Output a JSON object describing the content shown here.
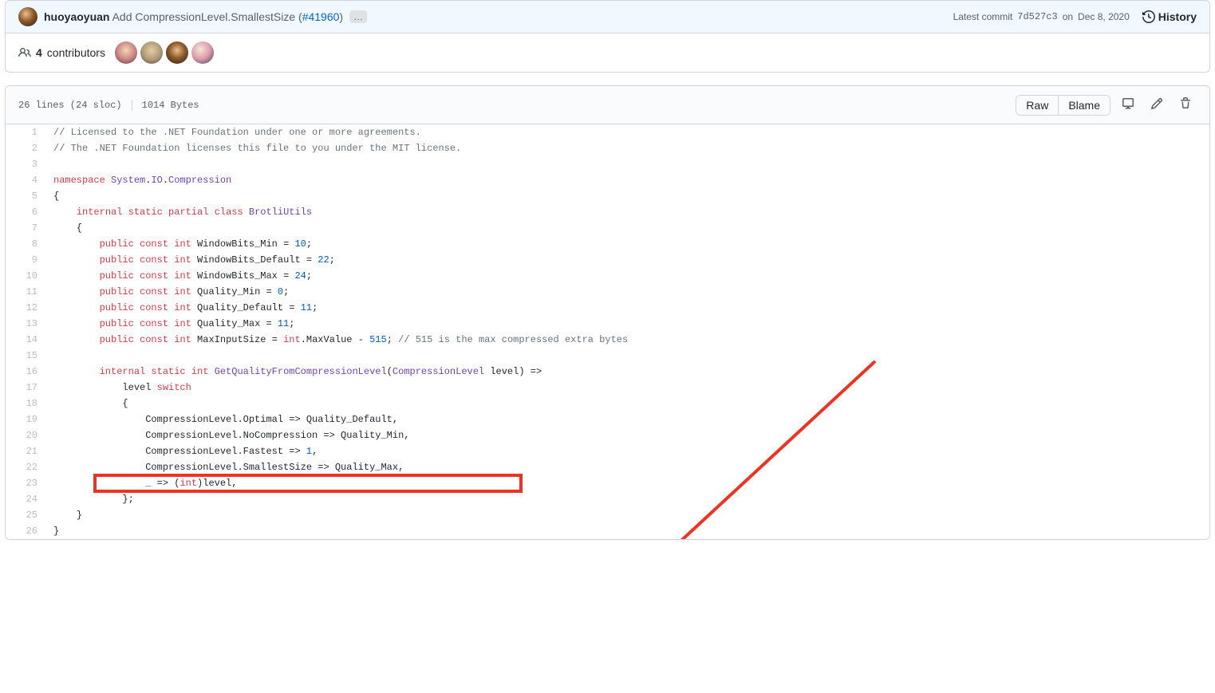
{
  "commit": {
    "author": "huoyaoyuan",
    "message_prefix": "Add CompressionLevel.SmallestSize (",
    "pr_number": "#41960",
    "message_suffix": ")",
    "ellipsis": "…",
    "latest_label": "Latest commit",
    "sha": "7d527c3",
    "on": "on",
    "date": "Dec 8, 2020",
    "history": "History"
  },
  "contributors": {
    "count": "4",
    "label": "contributors"
  },
  "file": {
    "lines_label": "26 lines (24 sloc)",
    "size_label": "1014 Bytes",
    "raw": "Raw",
    "blame": "Blame"
  },
  "code_lines": [
    {
      "n": "1",
      "tokens": [
        {
          "cls": "c-comment",
          "t": "// Licensed to the .NET Foundation under one or more agreements."
        }
      ]
    },
    {
      "n": "2",
      "tokens": [
        {
          "cls": "c-comment",
          "t": "// The .NET Foundation licenses this file to you under the MIT license."
        }
      ]
    },
    {
      "n": "3",
      "tokens": []
    },
    {
      "n": "4",
      "tokens": [
        {
          "cls": "c-keyword",
          "t": "namespace"
        },
        {
          "cls": "",
          "t": " "
        },
        {
          "cls": "c-type",
          "t": "System"
        },
        {
          "cls": "",
          "t": "."
        },
        {
          "cls": "c-type",
          "t": "IO"
        },
        {
          "cls": "",
          "t": "."
        },
        {
          "cls": "c-type",
          "t": "Compression"
        }
      ]
    },
    {
      "n": "5",
      "tokens": [
        {
          "cls": "",
          "t": "{"
        }
      ]
    },
    {
      "n": "6",
      "tokens": [
        {
          "cls": "",
          "t": "    "
        },
        {
          "cls": "c-keyword",
          "t": "internal"
        },
        {
          "cls": "",
          "t": " "
        },
        {
          "cls": "c-keyword",
          "t": "static"
        },
        {
          "cls": "",
          "t": " "
        },
        {
          "cls": "c-keyword",
          "t": "partial"
        },
        {
          "cls": "",
          "t": " "
        },
        {
          "cls": "c-keyword",
          "t": "class"
        },
        {
          "cls": "",
          "t": " "
        },
        {
          "cls": "c-type",
          "t": "BrotliUtils"
        }
      ]
    },
    {
      "n": "7",
      "tokens": [
        {
          "cls": "",
          "t": "    {"
        }
      ]
    },
    {
      "n": "8",
      "tokens": [
        {
          "cls": "",
          "t": "        "
        },
        {
          "cls": "c-keyword",
          "t": "public"
        },
        {
          "cls": "",
          "t": " "
        },
        {
          "cls": "c-keyword",
          "t": "const"
        },
        {
          "cls": "",
          "t": " "
        },
        {
          "cls": "c-keyword",
          "t": "int"
        },
        {
          "cls": "",
          "t": " WindowBits_Min = "
        },
        {
          "cls": "c-num",
          "t": "10"
        },
        {
          "cls": "",
          "t": ";"
        }
      ]
    },
    {
      "n": "9",
      "tokens": [
        {
          "cls": "",
          "t": "        "
        },
        {
          "cls": "c-keyword",
          "t": "public"
        },
        {
          "cls": "",
          "t": " "
        },
        {
          "cls": "c-keyword",
          "t": "const"
        },
        {
          "cls": "",
          "t": " "
        },
        {
          "cls": "c-keyword",
          "t": "int"
        },
        {
          "cls": "",
          "t": " WindowBits_Default = "
        },
        {
          "cls": "c-num",
          "t": "22"
        },
        {
          "cls": "",
          "t": ";"
        }
      ]
    },
    {
      "n": "10",
      "tokens": [
        {
          "cls": "",
          "t": "        "
        },
        {
          "cls": "c-keyword",
          "t": "public"
        },
        {
          "cls": "",
          "t": " "
        },
        {
          "cls": "c-keyword",
          "t": "const"
        },
        {
          "cls": "",
          "t": " "
        },
        {
          "cls": "c-keyword",
          "t": "int"
        },
        {
          "cls": "",
          "t": " WindowBits_Max = "
        },
        {
          "cls": "c-num",
          "t": "24"
        },
        {
          "cls": "",
          "t": ";"
        }
      ]
    },
    {
      "n": "11",
      "tokens": [
        {
          "cls": "",
          "t": "        "
        },
        {
          "cls": "c-keyword",
          "t": "public"
        },
        {
          "cls": "",
          "t": " "
        },
        {
          "cls": "c-keyword",
          "t": "const"
        },
        {
          "cls": "",
          "t": " "
        },
        {
          "cls": "c-keyword",
          "t": "int"
        },
        {
          "cls": "",
          "t": " Quality_Min = "
        },
        {
          "cls": "c-num",
          "t": "0"
        },
        {
          "cls": "",
          "t": ";"
        }
      ]
    },
    {
      "n": "12",
      "tokens": [
        {
          "cls": "",
          "t": "        "
        },
        {
          "cls": "c-keyword",
          "t": "public"
        },
        {
          "cls": "",
          "t": " "
        },
        {
          "cls": "c-keyword",
          "t": "const"
        },
        {
          "cls": "",
          "t": " "
        },
        {
          "cls": "c-keyword",
          "t": "int"
        },
        {
          "cls": "",
          "t": " Quality_Default = "
        },
        {
          "cls": "c-num",
          "t": "11"
        },
        {
          "cls": "",
          "t": ";"
        }
      ]
    },
    {
      "n": "13",
      "tokens": [
        {
          "cls": "",
          "t": "        "
        },
        {
          "cls": "c-keyword",
          "t": "public"
        },
        {
          "cls": "",
          "t": " "
        },
        {
          "cls": "c-keyword",
          "t": "const"
        },
        {
          "cls": "",
          "t": " "
        },
        {
          "cls": "c-keyword",
          "t": "int"
        },
        {
          "cls": "",
          "t": " Quality_Max = "
        },
        {
          "cls": "c-num",
          "t": "11"
        },
        {
          "cls": "",
          "t": ";"
        }
      ]
    },
    {
      "n": "14",
      "tokens": [
        {
          "cls": "",
          "t": "        "
        },
        {
          "cls": "c-keyword",
          "t": "public"
        },
        {
          "cls": "",
          "t": " "
        },
        {
          "cls": "c-keyword",
          "t": "const"
        },
        {
          "cls": "",
          "t": " "
        },
        {
          "cls": "c-keyword",
          "t": "int"
        },
        {
          "cls": "",
          "t": " MaxInputSize = "
        },
        {
          "cls": "c-keyword",
          "t": "int"
        },
        {
          "cls": "",
          "t": ".MaxValue - "
        },
        {
          "cls": "c-num",
          "t": "515"
        },
        {
          "cls": "",
          "t": "; "
        },
        {
          "cls": "c-comment",
          "t": "// 515 is the max compressed extra bytes"
        }
      ]
    },
    {
      "n": "15",
      "tokens": []
    },
    {
      "n": "16",
      "tokens": [
        {
          "cls": "",
          "t": "        "
        },
        {
          "cls": "c-keyword",
          "t": "internal"
        },
        {
          "cls": "",
          "t": " "
        },
        {
          "cls": "c-keyword",
          "t": "static"
        },
        {
          "cls": "",
          "t": " "
        },
        {
          "cls": "c-keyword",
          "t": "int"
        },
        {
          "cls": "",
          "t": " "
        },
        {
          "cls": "c-type",
          "t": "GetQualityFromCompressionLevel"
        },
        {
          "cls": "",
          "t": "("
        },
        {
          "cls": "c-type",
          "t": "CompressionLevel"
        },
        {
          "cls": "",
          "t": " "
        },
        {
          "cls": "c-ident",
          "t": "level"
        },
        {
          "cls": "",
          "t": ") =>"
        }
      ]
    },
    {
      "n": "17",
      "tokens": [
        {
          "cls": "",
          "t": "            level "
        },
        {
          "cls": "c-keyword",
          "t": "switch"
        }
      ]
    },
    {
      "n": "18",
      "tokens": [
        {
          "cls": "",
          "t": "            {"
        }
      ]
    },
    {
      "n": "19",
      "tokens": [
        {
          "cls": "",
          "t": "                CompressionLevel.Optimal => Quality_Default,"
        }
      ]
    },
    {
      "n": "20",
      "tokens": [
        {
          "cls": "",
          "t": "                CompressionLevel.NoCompression => Quality_Min,"
        }
      ]
    },
    {
      "n": "21",
      "tokens": [
        {
          "cls": "",
          "t": "                CompressionLevel.Fastest => "
        },
        {
          "cls": "c-num",
          "t": "1"
        },
        {
          "cls": "",
          "t": ","
        }
      ]
    },
    {
      "n": "22",
      "tokens": [
        {
          "cls": "",
          "t": "                CompressionLevel.SmallestSize => Quality_Max,"
        }
      ]
    },
    {
      "n": "23",
      "tokens": [
        {
          "cls": "",
          "t": "                "
        },
        {
          "cls": "c-num",
          "t": "_"
        },
        {
          "cls": "",
          "t": " => ("
        },
        {
          "cls": "c-keyword",
          "t": "int"
        },
        {
          "cls": "",
          "t": ")level,"
        }
      ],
      "highlight": true
    },
    {
      "n": "24",
      "tokens": [
        {
          "cls": "",
          "t": "            };"
        }
      ]
    },
    {
      "n": "25",
      "tokens": [
        {
          "cls": "",
          "t": "    }"
        }
      ]
    },
    {
      "n": "26",
      "tokens": [
        {
          "cls": "",
          "t": "}"
        }
      ]
    }
  ]
}
